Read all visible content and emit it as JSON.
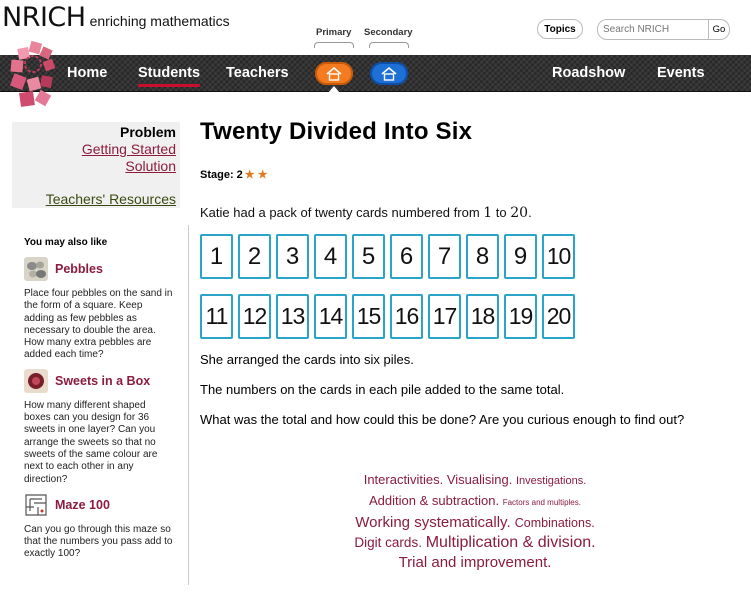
{
  "brand": {
    "name": "NRICH",
    "tagline": "enriching mathematics"
  },
  "header": {
    "topics": "Topics",
    "search_placeholder": "Search NRICH",
    "search_go": "Go",
    "primary_label": "Primary",
    "secondary_label": "Secondary"
  },
  "nav": {
    "home": "Home",
    "students": "Students",
    "teachers": "Teachers",
    "roadshow": "Roadshow",
    "events": "Events"
  },
  "sidebar": {
    "heading": "Problem",
    "getting_started": "Getting Started",
    "solution": "Solution",
    "teachers_resources": "Teachers' Resources",
    "also_like": "You may also like",
    "related": [
      {
        "title": "Pebbles",
        "desc": "Place four pebbles on the sand in the form of a square. Keep adding as few pebbles as necessary to double the area. How many extra pebbles are added each time?"
      },
      {
        "title": "Sweets in a Box",
        "desc": "How many different shaped boxes can you design for 36 sweets in one layer? Can you arrange the sweets so that no sweets of the same colour are next to each other in any direction?"
      },
      {
        "title": "Maze 100",
        "desc": "Can you go through this maze so that the numbers you pass add to exactly 100?"
      }
    ]
  },
  "main": {
    "title": "Twenty Divided Into Six",
    "stage_label": "Stage: 2",
    "stars": "★ ★",
    "intro_a": "Katie had a pack of twenty cards numbered from ",
    "intro_n1": "1",
    "intro_b": " to ",
    "intro_n2": "20",
    "intro_c": ".",
    "cards_row1": [
      "1",
      "2",
      "3",
      "4",
      "5",
      "6",
      "7",
      "8",
      "9",
      "10"
    ],
    "cards_row2": [
      "11",
      "12",
      "13",
      "14",
      "15",
      "16",
      "17",
      "18",
      "19",
      "20"
    ],
    "p1": "She arranged the cards into six piles.",
    "p2": "The numbers on the cards in each pile added to the same total.",
    "p3": "What was the total and how could this be done? Are you curious enough to find out?"
  },
  "tags": [
    {
      "text": "Interactivities",
      "size": 13
    },
    {
      "text": "Visualising",
      "size": 13
    },
    {
      "text": "Investigations",
      "size": 11
    },
    {
      "text": "Addition & subtraction",
      "size": 13
    },
    {
      "text": "Factors and multiples",
      "size": 8
    },
    {
      "text": "Working systematically",
      "size": 15
    },
    {
      "text": "Combinations",
      "size": 12.5
    },
    {
      "text": "Digit cards",
      "size": 13.5
    },
    {
      "text": "Multiplication & division",
      "size": 16
    },
    {
      "text": "Trial and improvement",
      "size": 15
    }
  ]
}
